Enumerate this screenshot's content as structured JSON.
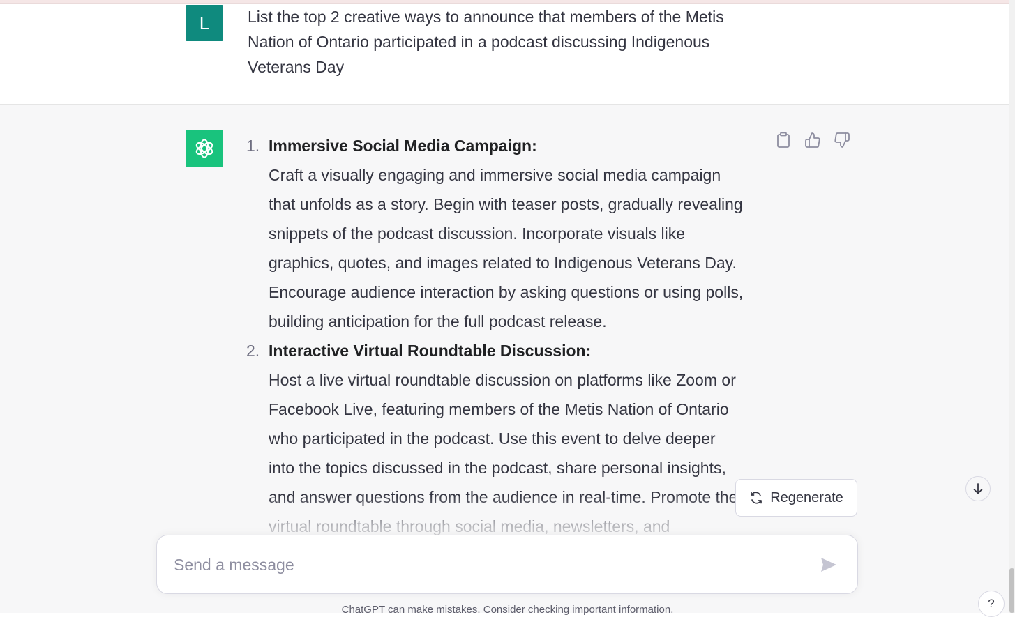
{
  "user_message": {
    "avatar_letter": "L",
    "lines": [
      "List the top 2 creative ways to announce that members of the Metis",
      "Nation of Ontario participated in a podcast discussing Indigenous",
      "Veterans Day"
    ]
  },
  "assistant_message": {
    "items": [
      {
        "number": "1.",
        "title": "Immersive Social Media Campaign:",
        "lines": [
          "Craft a visually engaging and immersive social media campaign",
          "that unfolds as a story. Begin with teaser posts, gradually revealing",
          "snippets of the podcast discussion. Incorporate visuals like",
          "graphics, quotes, and images related to Indigenous Veterans Day.",
          "Encourage audience interaction by asking questions or using polls,",
          "building anticipation for the full podcast release."
        ]
      },
      {
        "number": "2.",
        "title": "Interactive Virtual Roundtable Discussion:",
        "lines": [
          "Host a live virtual roundtable discussion on platforms like Zoom or",
          "Facebook Live, featuring members of the Metis Nation of Ontario",
          "who participated in the podcast. Use this event to delve deeper",
          "into the topics discussed in the podcast, share personal insights,",
          "and answer questions from the audience in real-time. Promote the",
          "virtual roundtable through social media, newsletters, and"
        ]
      }
    ],
    "actions": [
      "copy-icon",
      "thumbs-up-icon",
      "thumbs-down-icon"
    ]
  },
  "regenerate_label": "Regenerate",
  "composer": {
    "placeholder": "Send a message"
  },
  "disclaimer": "ChatGPT can make mistakes. Consider checking important information.",
  "help_label": "?",
  "colors": {
    "user_avatar": "#0f8a7e",
    "assistant_avatar": "#19c37d",
    "assistant_bg": "#f7f7f8"
  }
}
